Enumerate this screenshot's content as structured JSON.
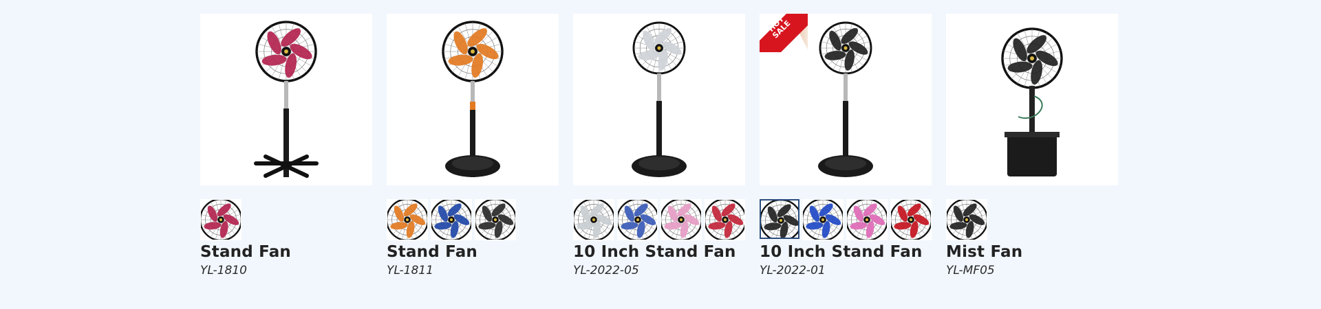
{
  "products": [
    {
      "title": "Stand Fan",
      "model": "YL-1810",
      "blade_color": "#b3244f",
      "base": "cross",
      "thumbnails": [
        {
          "color": "#b3244f"
        }
      ]
    },
    {
      "title": "Stand Fan",
      "model": "YL-1811",
      "blade_color": "#e37b22",
      "base": "round",
      "thumbnails": [
        {
          "color": "#e37b22"
        },
        {
          "color": "#2148a8"
        },
        {
          "color": "#2a2a2a"
        }
      ]
    },
    {
      "title": "10 Inch Stand Fan",
      "model": "YL-2022-05",
      "blade_color": "#cfd4d9",
      "base": "round",
      "thumbnails": [
        {
          "color": "#c9ced3"
        },
        {
          "color": "#3a5bb8"
        },
        {
          "color": "#e79cc6"
        },
        {
          "color": "#c3253a"
        }
      ]
    },
    {
      "title": "10 Inch Stand Fan",
      "model": "YL-2022-01",
      "blade_color": "#222222",
      "base": "round",
      "badge": "HOT SALE",
      "thumbnails": [
        {
          "color": "#222222",
          "selected": true
        },
        {
          "color": "#1f49c6"
        },
        {
          "color": "#e06ab7"
        },
        {
          "color": "#c5141f"
        }
      ]
    },
    {
      "title": "Mist Fan",
      "model": "YL-MF05",
      "blade_color": "#222222",
      "base": "mist",
      "thumbnails": [
        {
          "color": "#222222"
        }
      ]
    }
  ]
}
